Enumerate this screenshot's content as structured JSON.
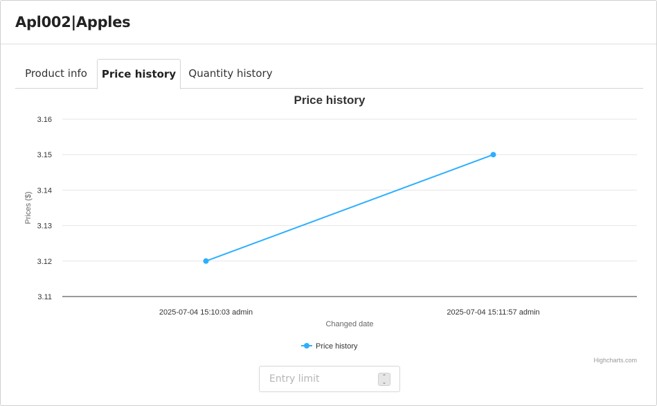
{
  "header": {
    "title": "Apl002|Apples"
  },
  "tabs": [
    {
      "label": "Product info",
      "active": false
    },
    {
      "label": "Price history",
      "active": true
    },
    {
      "label": "Quantity history",
      "active": false
    }
  ],
  "chart_data": {
    "type": "line",
    "title": "Price history",
    "xlabel": "Changed date",
    "ylabel": "Prices ($)",
    "categories": [
      "2025-07-04 15:10:03 admin",
      "2025-07-04 15:11:57 admin"
    ],
    "series": [
      {
        "name": "Price history",
        "values": [
          3.12,
          3.15
        ],
        "color": "#2caffe"
      }
    ],
    "ylim": [
      3.11,
      3.16
    ],
    "yticks": [
      "3.16",
      "3.15",
      "3.14",
      "3.13",
      "3.12",
      "3.11"
    ],
    "grid": true,
    "legend": "bottom-center",
    "credits": "Highcharts.com"
  },
  "entry_limit": {
    "placeholder": "Entry limit",
    "value": ""
  }
}
